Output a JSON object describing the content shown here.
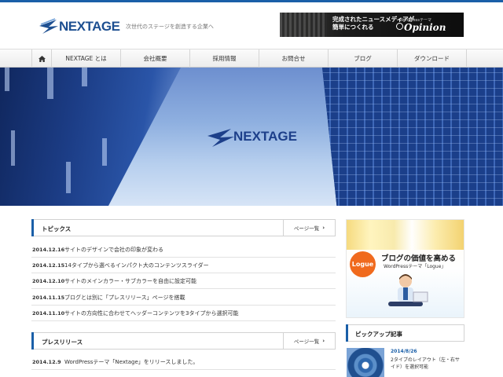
{
  "colors": {
    "accent": "#1a5fa8",
    "logo": "#1d4f91",
    "badge": "#f06a1d"
  },
  "header": {
    "logo_text": "NEXTAGE",
    "tagline": "次世代のステージを創造する企業へ",
    "banner": {
      "line1": "完成されたニュースメディアが",
      "line2": "簡単につくれる",
      "small": "WordPressテーマ",
      "product": "Opinion"
    }
  },
  "nav": {
    "home_icon": "home-icon",
    "items": [
      "NEXTAGE とは",
      "会社概要",
      "採用情報",
      "お問合せ",
      "ブログ",
      "ダウンロード"
    ]
  },
  "hero": {
    "logo_text": "NEXTAGE"
  },
  "topics": {
    "title": "トピックス",
    "more": "ページ一覧",
    "items": [
      {
        "date": "2014.12.16",
        "title": "サイトのデザインで会社の印象が変わる"
      },
      {
        "date": "2014.12.15",
        "title": "14タイプから選べるインパクト大のコンテンツスライダー"
      },
      {
        "date": "2014.12.10",
        "title": "サイトのメインカラー・サブカラーを自由に設定可能"
      },
      {
        "date": "2014.11.15",
        "title": "ブログとは別に「プレスリリース」ページを搭載"
      },
      {
        "date": "2014.11.10",
        "title": "サイトの方向性に合わせてヘッダーコンテンツを3タイプから選択可能"
      }
    ]
  },
  "press": {
    "title": "プレスリリース",
    "more": "ページ一覧",
    "items": [
      {
        "date": "2014.12.9",
        "title": "WordPressテーマ「Nextage」をリリースしました。"
      }
    ]
  },
  "sidebar": {
    "ad": {
      "badge": "Logue",
      "title": "ブログの価値を高める",
      "sub": "WordPressテーマ「Logue」"
    },
    "pickup": {
      "title": "ピックアップ記事",
      "items": [
        {
          "date": "2014/8/26",
          "title": "2タイプのレイアウト（左・右サイド）を選択可能"
        }
      ]
    }
  }
}
